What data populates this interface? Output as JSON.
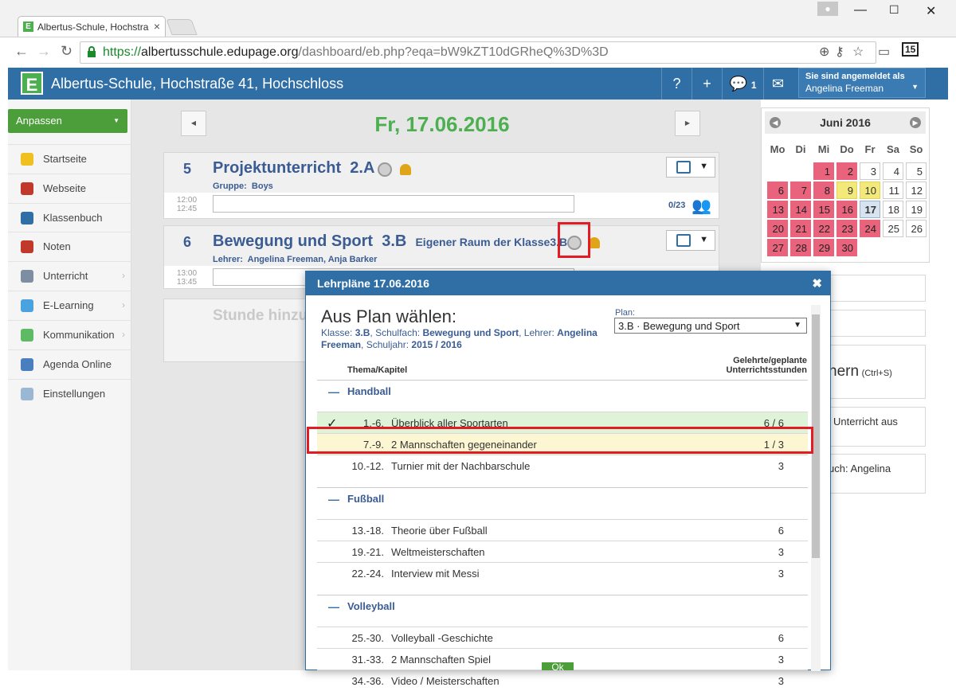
{
  "browser": {
    "tab_title": "Albertus-Schule, Hochstra",
    "favicon_letter": "E",
    "url_scheme": "https://",
    "url_host": "albertusschule.edupage.org",
    "url_path": "/dashboard/eb.php?eqa=bW9kZT10dGRheQ%3D%3D",
    "ext_badge": "15"
  },
  "header": {
    "logo": "E",
    "school": "Albertus-Schule, Hochstraße 41, Hochschloss",
    "help": "?",
    "add": "+",
    "messages_count": "1",
    "login_label": "Sie sind angemeldet als",
    "login_user": "Angelina Freeman"
  },
  "sidebar": {
    "customize": "Anpassen",
    "items": [
      {
        "label": "Startseite",
        "icon": "star-icon",
        "color": "#f0c020"
      },
      {
        "label": "Webseite",
        "icon": "house-icon",
        "color": "#c0392b"
      },
      {
        "label": "Klassenbuch",
        "icon": "book-icon",
        "color": "#2f6fa5"
      },
      {
        "label": "Noten",
        "icon": "grades-icon",
        "color": "#c0392b"
      },
      {
        "label": "Unterricht",
        "icon": "teaching-icon",
        "color": "#7d8ea3"
      },
      {
        "label": "E-Learning",
        "icon": "elearning-icon",
        "color": "#4aa3df"
      },
      {
        "label": "Kommunikation",
        "icon": "communication-icon",
        "color": "#5dbb63"
      },
      {
        "label": "Agenda Online",
        "icon": "pen-icon",
        "color": "#4a7fbf"
      },
      {
        "label": "Einstellungen",
        "icon": "settings-icon",
        "color": "#9ab8d4"
      }
    ]
  },
  "main": {
    "date": "Fr, 17.06.2016",
    "lessons": [
      {
        "num": "5",
        "subject": "Projektunterricht",
        "class": "2.A",
        "room": "",
        "info_label": "Gruppe:",
        "info_value": "Boys",
        "start": "12:00",
        "end": "12:45",
        "count": "0/23"
      },
      {
        "num": "6",
        "subject": "Bewegung und Sport",
        "class": "3.B",
        "room": "Eigener Raum der Klasse3.B",
        "info_label": "Lehrer:",
        "info_value": "Angelina Freeman, Anja Barker",
        "start": "13:00",
        "end": "13:45",
        "count": ""
      }
    ],
    "add_lesson": "Stunde hinzu"
  },
  "calendar": {
    "month": "Juni 2016",
    "weekdays": [
      "Mo",
      "Di",
      "Mi",
      "Do",
      "Fr",
      "Sa",
      "So"
    ],
    "weeks": [
      [
        {
          "d": "",
          "s": "e"
        },
        {
          "d": "",
          "s": "e"
        },
        {
          "d": "1",
          "s": "r"
        },
        {
          "d": "2",
          "s": "r"
        },
        {
          "d": "3",
          "s": "w"
        },
        {
          "d": "4",
          "s": "w"
        },
        {
          "d": "5",
          "s": "w"
        }
      ],
      [
        {
          "d": "6",
          "s": "r"
        },
        {
          "d": "7",
          "s": "r"
        },
        {
          "d": "8",
          "s": "r"
        },
        {
          "d": "9",
          "s": "y"
        },
        {
          "d": "10",
          "s": "y"
        },
        {
          "d": "11",
          "s": "w"
        },
        {
          "d": "12",
          "s": "w"
        }
      ],
      [
        {
          "d": "13",
          "s": "r"
        },
        {
          "d": "14",
          "s": "r"
        },
        {
          "d": "15",
          "s": "r"
        },
        {
          "d": "16",
          "s": "r"
        },
        {
          "d": "17",
          "s": "b"
        },
        {
          "d": "18",
          "s": "w"
        },
        {
          "d": "19",
          "s": "w"
        }
      ],
      [
        {
          "d": "20",
          "s": "r"
        },
        {
          "d": "21",
          "s": "r"
        },
        {
          "d": "22",
          "s": "r"
        },
        {
          "d": "23",
          "s": "r"
        },
        {
          "d": "24",
          "s": "r"
        },
        {
          "d": "25",
          "s": "w"
        },
        {
          "d": "26",
          "s": "w"
        }
      ],
      [
        {
          "d": "27",
          "s": "r"
        },
        {
          "d": "28",
          "s": "r"
        },
        {
          "d": "29",
          "s": "r"
        },
        {
          "d": "30",
          "s": "r"
        },
        {
          "d": "",
          "s": "e"
        },
        {
          "d": "",
          "s": "e"
        },
        {
          "d": "",
          "s": "e"
        }
      ]
    ]
  },
  "right_panels": {
    "save": "hern",
    "save_shortcut": "(Ctrl+S)",
    "import": "Unterricht aus",
    "book": "uch: Angelina"
  },
  "dialog": {
    "title": "Lehrpläne 17.06.2016",
    "heading": "Aus Plan wählen:",
    "klasse_label": "Klasse:",
    "klasse": "3.B",
    "fach_label": "Schulfach:",
    "fach": "Bewegung und Sport",
    "lehrer_label": "Lehrer:",
    "lehrer": "Angelina Freeman",
    "jahr_label": "Schuljahr:",
    "jahr": "2015 / 2016",
    "plan_label": "Plan:",
    "plan_value": "3.B · Bewegung und Sport",
    "col_topic": "Thema/Kapitel",
    "col_hours_1": "Gelehrte/geplante",
    "col_hours_2": "Unterrichtsstunden",
    "groups": [
      {
        "name": "Handball",
        "rows": [
          {
            "n": "1.-6.",
            "t": "Überblick aller Sportarten",
            "v": "6 / 6",
            "state": "done"
          },
          {
            "n": "7.-9.",
            "t": "2 Mannschaften gegeneinander",
            "v": "1 / 3",
            "state": "cur"
          },
          {
            "n": "10.-12.",
            "t": "Turnier mit der Nachbarschule",
            "v": "3",
            "state": ""
          }
        ]
      },
      {
        "name": "Fußball",
        "rows": [
          {
            "n": "13.-18.",
            "t": "Theorie über Fußball",
            "v": "6",
            "state": ""
          },
          {
            "n": "19.-21.",
            "t": "Weltmeisterschaften",
            "v": "3",
            "state": ""
          },
          {
            "n": "22.-24.",
            "t": "Interview mit Messi",
            "v": "3",
            "state": ""
          }
        ]
      },
      {
        "name": "Volleyball",
        "rows": [
          {
            "n": "25.-30.",
            "t": "Volleyball -Geschichte",
            "v": "6",
            "state": ""
          },
          {
            "n": "31.-33.",
            "t": "2 Mannschaften Spiel",
            "v": "3",
            "state": ""
          },
          {
            "n": "34.-36.",
            "t": "Video / Meisterschaften",
            "v": "3",
            "state": ""
          }
        ]
      }
    ],
    "ok": "Ok"
  }
}
